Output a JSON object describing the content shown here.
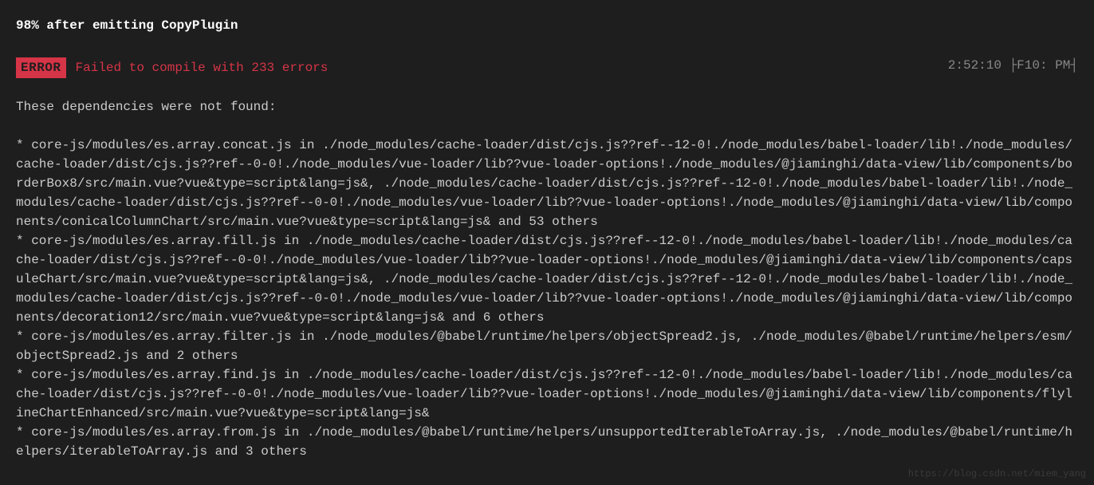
{
  "header": {
    "title": "98% after emitting CopyPlugin"
  },
  "error": {
    "badge": "ERROR",
    "message": "Failed to compile with 233 errors",
    "timestamp": "2:52:10 ├F10: PM┤"
  },
  "depsHeading": "These dependencies were not found:",
  "logLines": [
    "* core-js/modules/es.array.concat.js in ./node_modules/cache-loader/dist/cjs.js??ref--12-0!./node_modules/babel-loader/lib!./node_modules/cache-loader/dist/cjs.js??ref--0-0!./node_modules/vue-loader/lib??vue-loader-options!./node_modules/@jiaminghi/data-view/lib/components/borderBox8/src/main.vue?vue&type=script&lang=js&, ./node_modules/cache-loader/dist/cjs.js??ref--12-0!./node_modules/babel-loader/lib!./node_modules/cache-loader/dist/cjs.js??ref--0-0!./node_modules/vue-loader/lib??vue-loader-options!./node_modules/@jiaminghi/data-view/lib/components/conicalColumnChart/src/main.vue?vue&type=script&lang=js& and 53 others",
    "* core-js/modules/es.array.fill.js in ./node_modules/cache-loader/dist/cjs.js??ref--12-0!./node_modules/babel-loader/lib!./node_modules/cache-loader/dist/cjs.js??ref--0-0!./node_modules/vue-loader/lib??vue-loader-options!./node_modules/@jiaminghi/data-view/lib/components/capsuleChart/src/main.vue?vue&type=script&lang=js&, ./node_modules/cache-loader/dist/cjs.js??ref--12-0!./node_modules/babel-loader/lib!./node_modules/cache-loader/dist/cjs.js??ref--0-0!./node_modules/vue-loader/lib??vue-loader-options!./node_modules/@jiaminghi/data-view/lib/components/decoration12/src/main.vue?vue&type=script&lang=js& and 6 others",
    "* core-js/modules/es.array.filter.js in ./node_modules/@babel/runtime/helpers/objectSpread2.js, ./node_modules/@babel/runtime/helpers/esm/objectSpread2.js and 2 others",
    "* core-js/modules/es.array.find.js in ./node_modules/cache-loader/dist/cjs.js??ref--12-0!./node_modules/babel-loader/lib!./node_modules/cache-loader/dist/cjs.js??ref--0-0!./node_modules/vue-loader/lib??vue-loader-options!./node_modules/@jiaminghi/data-view/lib/components/flylineChartEnhanced/src/main.vue?vue&type=script&lang=js&",
    "* core-js/modules/es.array.from.js in ./node_modules/@babel/runtime/helpers/unsupportedIterableToArray.js, ./node_modules/@babel/runtime/helpers/iterableToArray.js and 3 others"
  ],
  "watermark": "https://blog.csdn.net/miem_yang"
}
